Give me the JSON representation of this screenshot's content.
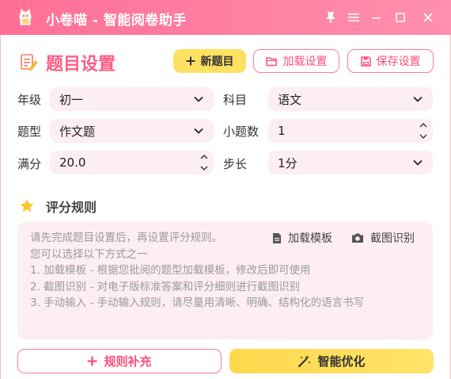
{
  "app": {
    "title": "小卷喵 - 智能阅卷助手",
    "accent": "#ff6f96",
    "window_buttons": [
      "pin-icon",
      "menu-icon",
      "minimize-icon",
      "maximize-icon",
      "close-icon"
    ]
  },
  "header": {
    "title": "题目设置",
    "new_button": "新题目",
    "load_button": "加载设置",
    "save_button": "保存设置"
  },
  "form": {
    "grade_label": "年级",
    "grade_value": "初一",
    "subject_label": "科目",
    "subject_value": "语文",
    "type_label": "题型",
    "type_value": "作文题",
    "subcount_label": "小题数",
    "subcount_value": "1",
    "score_label": "满分",
    "score_value": "20.0",
    "step_label": "步长",
    "step_value": "1分"
  },
  "rules": {
    "title": "评分规则",
    "load_template": "加载模板",
    "screenshot_ocr": "截图识别",
    "placeholder": "请先完成题目设置后，再设置评分规则。\n您可以选择以下方式之一\n1. 加载模板 - 根据您批阅的题型加载模板，修改后即可使用\n2. 截图识别 - 对电子版标准答案和评分细则进行截图识别\n3. 手动输入 - 手动输入规则，请尽量用清晰、明确、结构化的语言书写"
  },
  "footer": {
    "supplement_button": "规则补充",
    "optimize_button": "智能优化"
  }
}
